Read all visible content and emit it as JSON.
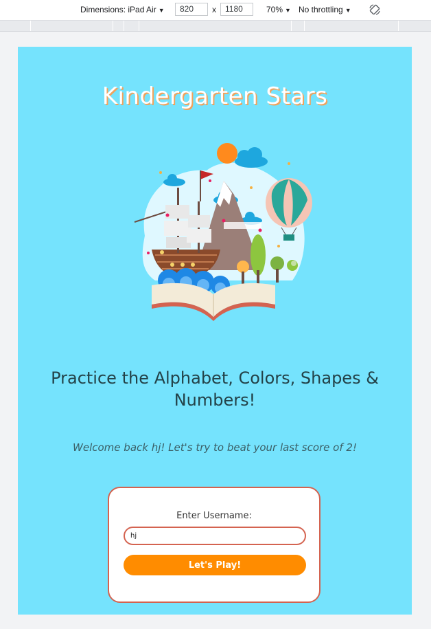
{
  "devtools": {
    "dimensions_label": "Dimensions: iPad Air",
    "width": "820",
    "times": "x",
    "height": "1180",
    "zoom": "70%",
    "throttling": "No throttling",
    "icons": [
      "caret-down-icon",
      "rotate-icon"
    ]
  },
  "page": {
    "title": "Kindergarten Stars",
    "subtitle": "Practice the Alphabet, Colors, Shapes & Numbers!",
    "welcome": "Welcome back hj! Let's try to beat your last score of 2!",
    "login": {
      "label": "Enter Username:",
      "input_value": "hj",
      "button_label": "Let's Play!"
    }
  },
  "colors": {
    "viewport_bg": "#75e3fd",
    "accent_orange": "#ff8c00",
    "border_red": "#d46350",
    "text_dark": "#234248"
  }
}
